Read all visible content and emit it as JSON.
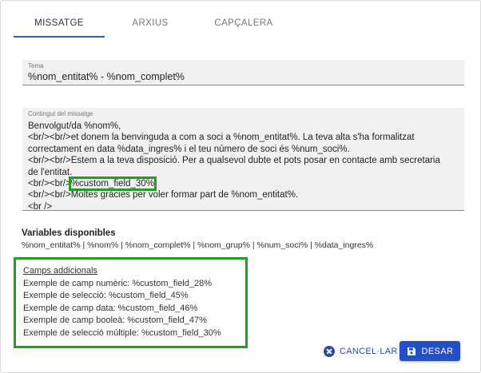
{
  "colors": {
    "accent": "#2450c7",
    "tab_indicator": "#2b5fd3",
    "highlight": "#1fa01f",
    "field_bg": "#f1f1f1"
  },
  "tabs": [
    {
      "label": "MISSATGE",
      "active": true
    },
    {
      "label": "ARXIUS",
      "active": false
    },
    {
      "label": "CAPÇALERA",
      "active": false
    }
  ],
  "title_field": {
    "label": "Tema",
    "value": "%nom_entitat% - %nom_complet%"
  },
  "body_field": {
    "label": "Contingut del missatge",
    "lines": [
      "Benvolgut/da %nom%,",
      "<br/><br/>et donem la benvinguda a com a soci a %nom_entitat%. La teva alta s'ha formalitzat",
      "correctament en data %data_ingres% i el teu número de soci és %num_soci%.",
      "<br/><br/>Estem a la teva disposició. Per a qualsevol dubte et pots posar en contacte amb secretaria",
      "de l'entitat.",
      "<br/><br/>",
      "%custom_field_30%",
      "<br/><br/>Moltes gràcies per voler formar part de %nom_entitat%.",
      "<br />"
    ]
  },
  "variables": {
    "title": "Variables disponibles",
    "list": "%nom_entitat% | %nom% | %nom_complet% | %nom_grup% | %num_soci% | %data_ingres%"
  },
  "camps_addicionals": {
    "title": "Camps addicionals",
    "items": [
      "Exemple de camp numèric: %custom_field_28%",
      "Exemple de selecció: %custom_field_45%",
      "Exemple de camp data: %custom_field_46%",
      "Exemple de camp booleà: %custom_field_47%",
      "Exemple de selecció múltiple: %custom_field_30%"
    ]
  },
  "actions": {
    "cancel_label": "CANCEL·LAR",
    "save_label": "DESAR"
  }
}
